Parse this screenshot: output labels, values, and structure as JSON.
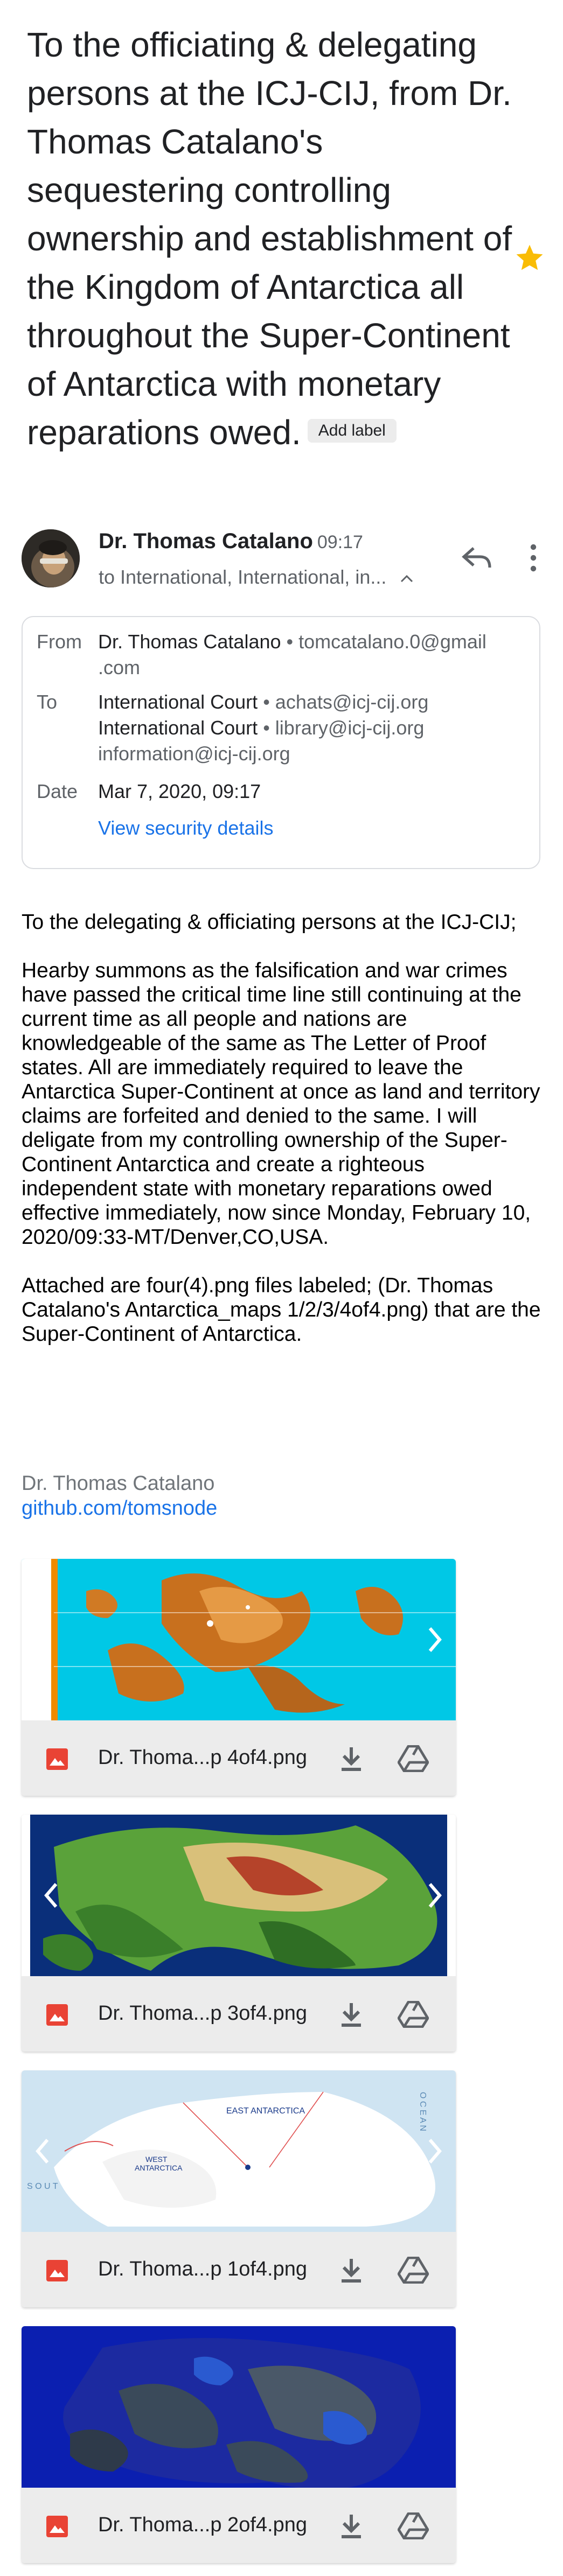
{
  "email": {
    "subject": "To the officiating & delegating persons at the ICJ-CIJ, from Dr. Thomas Catalano's sequestering controlling ownership and establishment of the Kingdom of Antarctica all throughout the Super-Continent of Antarctica with monetary reparations owed.",
    "add_label": "Add label",
    "sender_name": "Dr. Thomas Catalano",
    "time": "09:17",
    "to_summary": "to International, International, in...",
    "details": {
      "from_label": "From",
      "from_name": "Dr. Thomas Catalano",
      "from_email": "• tomcatalano.0@gmail",
      "from_email_cont": ".com",
      "to_label": "To",
      "to_1_name": "International Court",
      "to_1_email": "• achats@icj-cij.org",
      "to_2_name": "International Court",
      "to_2_email": "• library@icj-cij.org",
      "to_3": "information@icj-cij.org",
      "date_label": "Date",
      "date_value": "Mar 7, 2020, 09:17",
      "security_link": "View security details"
    },
    "body": "To the delegating & officiating persons at the ICJ-CIJ;\n\nHearby summons as the falsification and war crimes have passed the critical time line still continuing at the current time as all people and nations are knowledgeable of the same as The Letter of Proof states. All are immediately required to leave the Antarctica Super-Continent at once as land and territory claims are forfeited and denied to the same. I will deligate from my controlling ownership of the Super-Continent Antarctica and create a righteous independent state with monetary reparations owed effective immediately, now since Monday, February 10, 2020/09:33-MT/Denver,CO,USA.\n\nAttached are four(4).png files labeled; (Dr. Thomas Catalano's Antarctica_maps 1/2/3/4of4.png) that are the Super-Continent of Antarctica.",
    "signature_name": "Dr. Thomas Catalano",
    "signature_link": "github.com/tomsnode"
  },
  "attachments": [
    {
      "filename": "Dr. Thoma...p 4of4.png"
    },
    {
      "filename": "Dr. Thoma...p 3of4.png"
    },
    {
      "filename": "Dr. Thoma...p 1of4.png"
    },
    {
      "filename": "Dr. Thoma...p 2of4.png"
    }
  ],
  "thumb_labels": {
    "map1_east": "EAST ANTARCTICA",
    "map1_west": "WEST",
    "map1_west2": "ANTARCTICA",
    "map1_ocean": "O C E A N",
    "map1_south": "S O U T"
  },
  "icons": [
    "star-icon",
    "reply-icon",
    "more-vert-icon",
    "chevron-up-icon",
    "image-file-icon",
    "download-icon",
    "drive-icon",
    "chevron-left-icon",
    "chevron-right-icon"
  ],
  "colors": {
    "star": "#f9bc05",
    "link": "#1a73e8",
    "image_icon": "#e94335"
  }
}
